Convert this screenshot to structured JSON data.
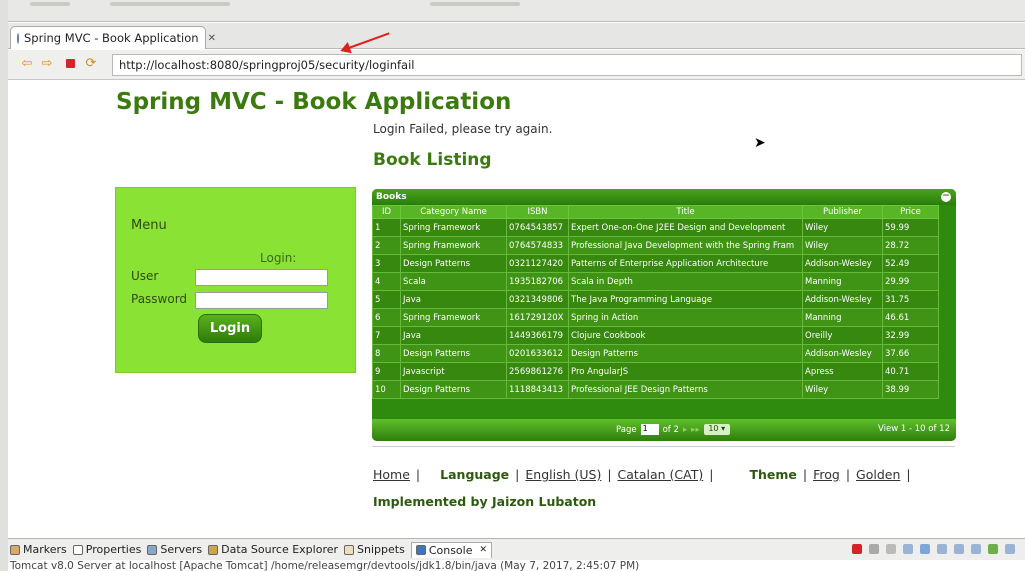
{
  "browser": {
    "tab_title": "Spring MVC - Book Application",
    "url": "http://localhost:8080/springproj05/security/loginfail"
  },
  "page": {
    "app_title": "Spring MVC - Book Application",
    "login_failed": "Login Failed, please try again.",
    "listing_title": "Book Listing",
    "implemented_by": "Implemented by Jaizon Lubaton"
  },
  "menu": {
    "title": "Menu",
    "login_title": "Login:",
    "user_label": "User",
    "password_label": "Password",
    "login_button": "Login"
  },
  "grid": {
    "caption": "Books",
    "columns": [
      "ID",
      "Category Name",
      "ISBN",
      "Title",
      "Publisher",
      "Price"
    ],
    "rows": [
      [
        "1",
        "Spring Framework",
        "0764543857",
        "Expert One-on-One J2EE Design and Development",
        "Wiley",
        "59.99"
      ],
      [
        "2",
        "Spring Framework",
        "0764574833",
        "Professional Java Development with the Spring Fram",
        "Wiley",
        "28.72"
      ],
      [
        "3",
        "Design Patterns",
        "0321127420",
        "Patterns of Enterprise Application Architecture",
        "Addison-Wesley",
        "52.49"
      ],
      [
        "4",
        "Scala",
        "1935182706",
        "Scala in Depth",
        "Manning",
        "29.99"
      ],
      [
        "5",
        "Java",
        "0321349806",
        "The Java Programming Language",
        "Addison-Wesley",
        "31.75"
      ],
      [
        "6",
        "Spring Framework",
        "161729120X",
        "Spring in Action",
        "Manning",
        "46.61"
      ],
      [
        "7",
        "Java",
        "1449366179",
        "Clojure Cookbook",
        "Oreilly",
        "32.99"
      ],
      [
        "8",
        "Design Patterns",
        "0201633612",
        "Design Patterns",
        "Addison-Wesley",
        "37.66"
      ],
      [
        "9",
        "Javascript",
        "2569861276",
        "Pro AngularJS",
        "Apress",
        "40.71"
      ],
      [
        "10",
        "Design Patterns",
        "1118843413",
        "Professional JEE Design Patterns",
        "Wiley",
        "38.99"
      ]
    ],
    "pager_page_label": "Page",
    "pager_page_value": "1",
    "pager_of": "of 2",
    "pager_rows": "10",
    "view_info": "View 1 - 10 of 12"
  },
  "footer": {
    "home": "Home",
    "language_label": "Language",
    "lang_en": "English (US)",
    "lang_ca": "Catalan (CAT)",
    "theme_label": "Theme",
    "theme_frog": "Frog",
    "theme_golden": "Golden"
  },
  "ide": {
    "views": [
      "Markers",
      "Properties",
      "Servers",
      "Data Source Explorer",
      "Snippets",
      "Console"
    ],
    "console_line": "Tomcat v8.0 Server at localhost [Apache Tomcat] /home/releasemgr/devtools/jdk1.8/bin/java (May 7, 2017, 2:45:07 PM)"
  },
  "colors": {
    "accent_green": "#3a7a0f",
    "menu_bg": "#8ae234",
    "grid_bg": "#2e8b0e",
    "annotation_red": "#e02020"
  }
}
